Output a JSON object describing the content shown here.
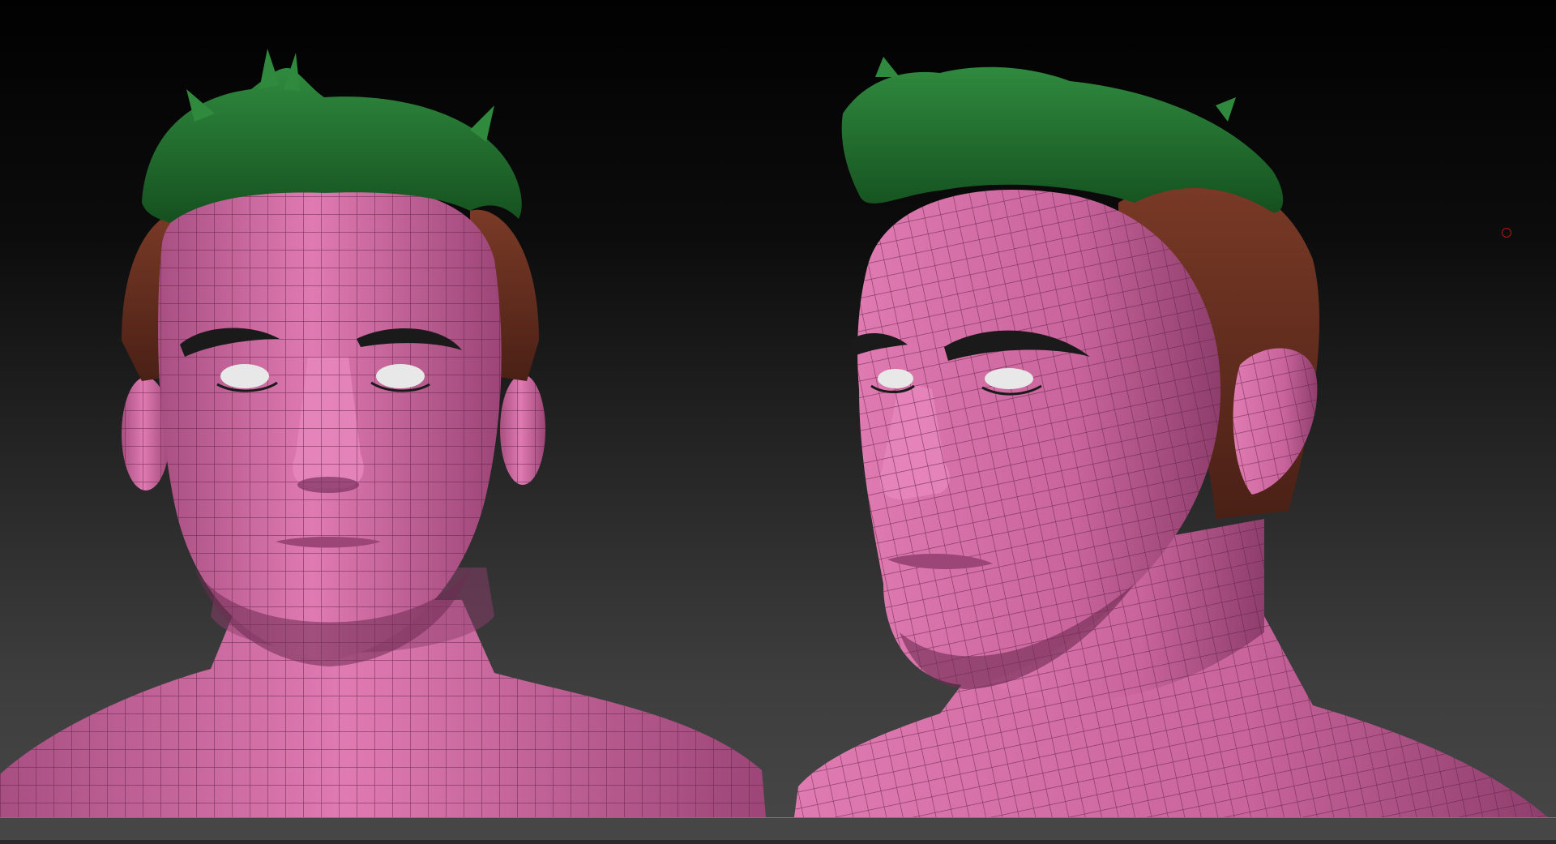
{
  "viewport": {
    "background_top": "#010101",
    "background_bottom": "#474747"
  },
  "models": [
    {
      "name": "head-front-view",
      "skin_color": "#d76ea8",
      "wire_color": "#5a2040",
      "hair_top_color": "#1f6b2c",
      "hair_side_color": "#6b3220",
      "eyebrow_color": "#1a1a1a",
      "eye_color": "#e8e8e8"
    },
    {
      "name": "head-three-quarter-view",
      "skin_color": "#d76ea8",
      "wire_color": "#5a2040",
      "hair_top_color": "#1f6b2c",
      "hair_side_color": "#6b3220",
      "eyebrow_color": "#1a1a1a",
      "eye_color": "#e8e8e8"
    }
  ],
  "cursor": {
    "icon": "brush-cursor-icon",
    "color": "#b01818"
  }
}
